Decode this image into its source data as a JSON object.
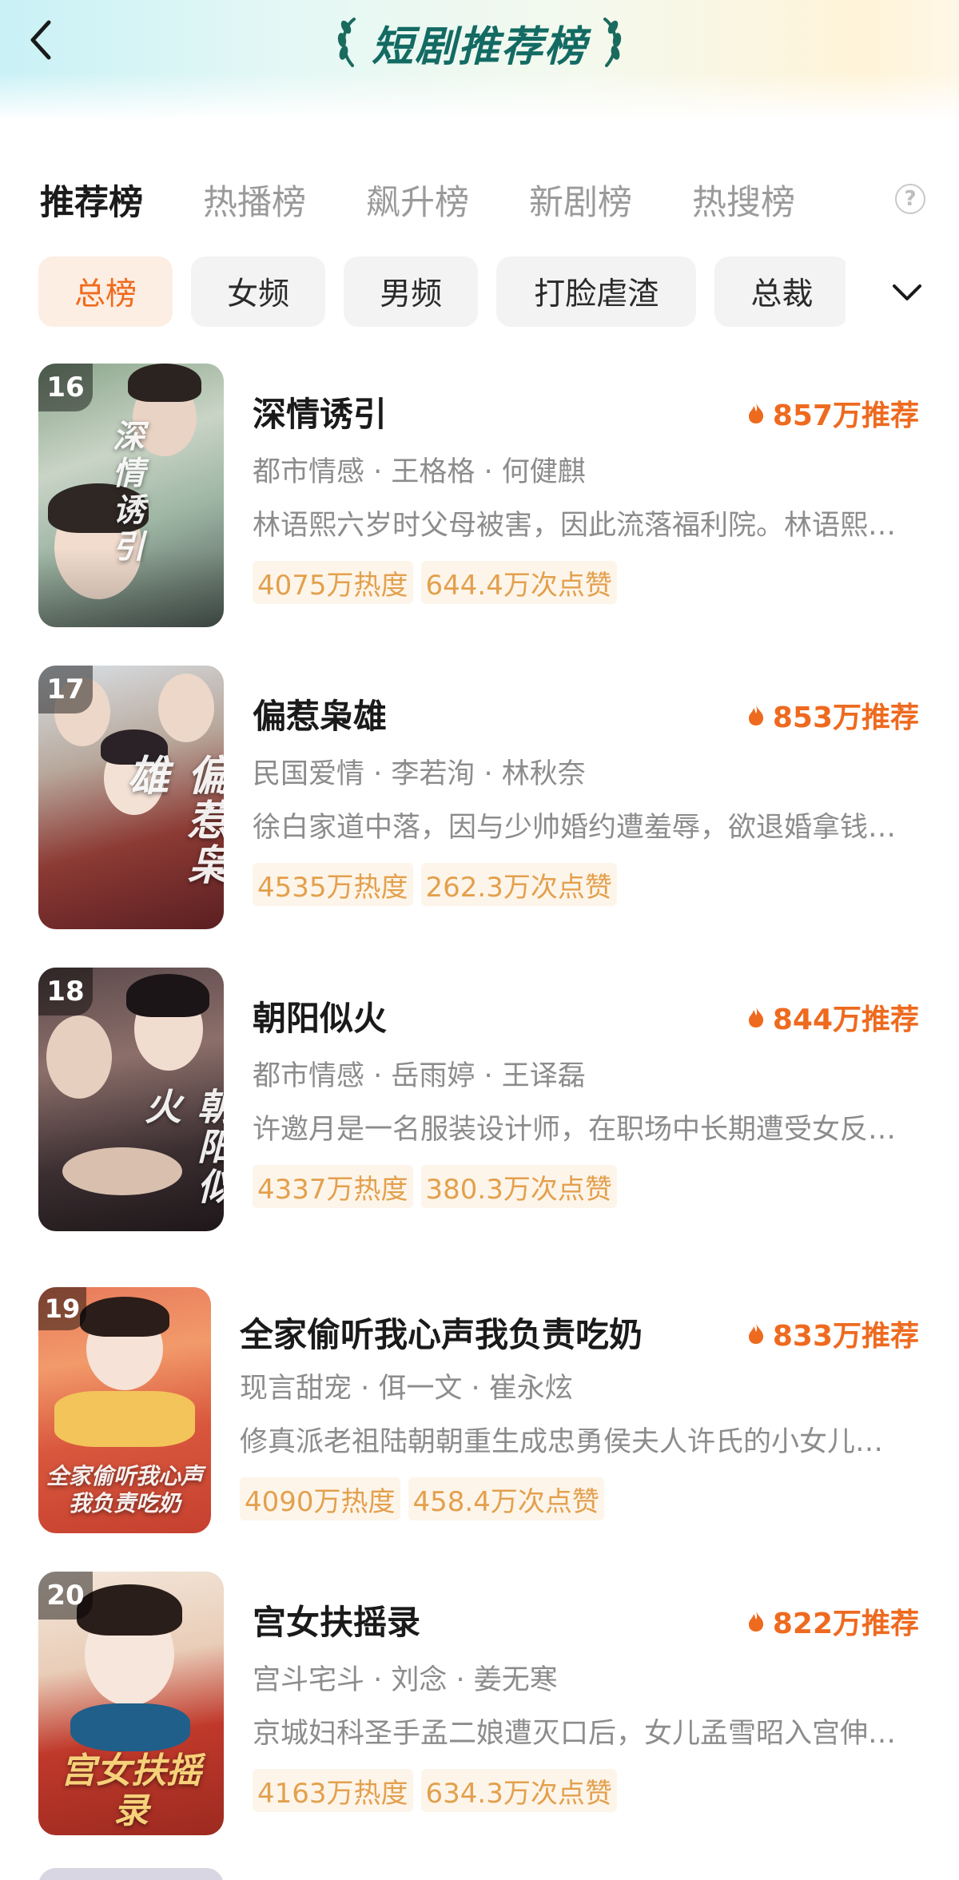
{
  "header": {
    "title": "短剧推荐榜"
  },
  "tabs": [
    {
      "label": "推荐榜",
      "active": true
    },
    {
      "label": "热播榜",
      "active": false
    },
    {
      "label": "飙升榜",
      "active": false
    },
    {
      "label": "新剧榜",
      "active": false
    },
    {
      "label": "热搜榜",
      "active": false
    }
  ],
  "help_icon": "?",
  "chips": [
    {
      "label": "总榜",
      "active": true
    },
    {
      "label": "女频",
      "active": false
    },
    {
      "label": "男频",
      "active": false
    },
    {
      "label": "打脸虐渣",
      "active": false
    },
    {
      "label": "总裁",
      "active": false
    }
  ],
  "dramas": [
    {
      "rank": "16",
      "title": "深情诱引",
      "recommend": "857万推荐",
      "meta": "都市情感 · 王格格 · 何健麒",
      "desc": "林语熙六岁时父母被害，因此流落福利院。林语熙…",
      "heat": "4075万热度",
      "likes": "644.4万次点赞",
      "poster_text": "深情诱引"
    },
    {
      "rank": "17",
      "title": "偏惹枭雄",
      "recommend": "853万推荐",
      "meta": "民国爱情 · 李若洵 · 林秋奈",
      "desc": "徐白家道中落，因与少帅婚约遭羞辱，欲退婚拿钱…",
      "heat": "4535万热度",
      "likes": "262.3万次点赞",
      "poster_text": "偏惹枭雄"
    },
    {
      "rank": "18",
      "title": "朝阳似火",
      "recommend": "844万推荐",
      "meta": "都市情感 · 岳雨婷 · 王译磊",
      "desc": "许邀月是一名服装设计师，在职场中长期遭受女反…",
      "heat": "4337万热度",
      "likes": "380.3万次点赞",
      "poster_text": "朝阳似火"
    },
    {
      "rank": "19",
      "title": "全家偷听我心声我负责吃奶",
      "recommend": "833万推荐",
      "meta": "现言甜宠 · 佴一文 · 崔永炫",
      "desc": "修真派老祖陆朝朝重生成忠勇侯夫人许氏的小女儿…",
      "heat": "4090万热度",
      "likes": "458.4万次点赞",
      "poster_text": "全家偷听我心声 我负责吃奶"
    },
    {
      "rank": "20",
      "title": "宫女扶摇录",
      "recommend": "822万推荐",
      "meta": "宫斗宅斗 · 刘念 · 姜无寒",
      "desc": "京城妇科圣手孟二娘遭灭口后，女儿孟雪昭入宫伸…",
      "heat": "4163万热度",
      "likes": "634.3万次点赞",
      "poster_text": "宫女扶摇录"
    }
  ],
  "colors": {
    "accent": "#ee6a1f",
    "title_green": "#136b63",
    "tag_text": "#e3a04d",
    "tag_bg": "#fdf5ea"
  },
  "icons": [
    "back-arrow-icon",
    "laurel-left-icon",
    "laurel-right-icon",
    "help-icon",
    "chevron-down-icon",
    "flame-icon"
  ]
}
